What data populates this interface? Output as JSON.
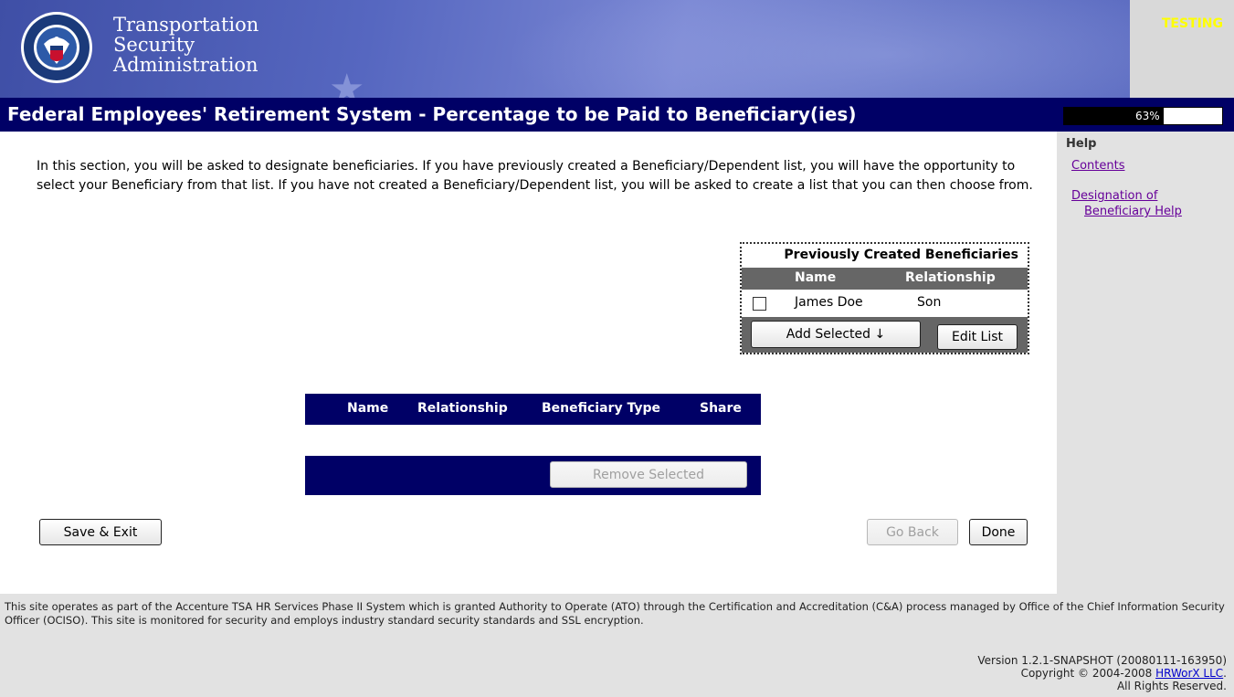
{
  "header": {
    "agency_line1": "Transportation",
    "agency_line2": "Security",
    "agency_line3": "Administration",
    "testing_badge": "TESTING",
    "seal_text": "U.S. DEPARTMENT OF HOMELAND SECURITY"
  },
  "titlebar": {
    "title": "Federal Employees' Retirement System - Percentage to be Paid to Beneficiary(ies)",
    "progress_label": "63%",
    "progress_value": 0.63
  },
  "sidebar": {
    "help_title": "Help",
    "links": [
      {
        "label": "Contents"
      },
      {
        "label_line1": "Designation of",
        "label_line2": "Beneficiary Help"
      }
    ]
  },
  "main": {
    "intro": "In this section, you will be asked to designate beneficiaries. If you have previously created a Beneficiary/Dependent list, you will have the opportunity to select your Beneficiary from that list. If you have not created a Beneficiary/Dependent list, you will be asked to create a list that you can then choose from.",
    "previous": {
      "title": "Previously Created Beneficiaries",
      "columns": [
        "Name",
        "Relationship"
      ],
      "rows": [
        {
          "name": "James Doe",
          "relationship": "Son",
          "checked": false
        }
      ],
      "add_selected_label": "Add Selected ↓",
      "edit_list_label": "Edit List"
    },
    "beneficiaries": {
      "columns": [
        "Name",
        "Relationship",
        "Beneficiary Type",
        "Share"
      ],
      "rows": [],
      "remove_selected_label": "Remove Selected"
    },
    "save_exit_label": "Save & Exit",
    "go_back_label": "Go Back",
    "done_label": "Done"
  },
  "footer": {
    "legal": "This site operates as part of the Accenture TSA HR Services Phase II System which is granted Authority to Operate (ATO) through the Certification and Accreditation (C&A) process managed by Office of the Chief Information Security Officer (OCISO). This site is monitored for security and employs industry standard security standards and SSL encryption.",
    "version": "Version 1.2.1-SNAPSHOT (20080111-163950)",
    "copyright_prefix": "Copyright © 2004-2008 ",
    "company_link": "HRWorX LLC",
    "copyright_suffix": ".",
    "rights": "All Rights Reserved."
  },
  "colors": {
    "title_bar": "#000066",
    "banner": "#5565bd",
    "sidebar_bg": "#e2e2e2",
    "link_visited": "#660099",
    "testing": "#ffff00"
  }
}
